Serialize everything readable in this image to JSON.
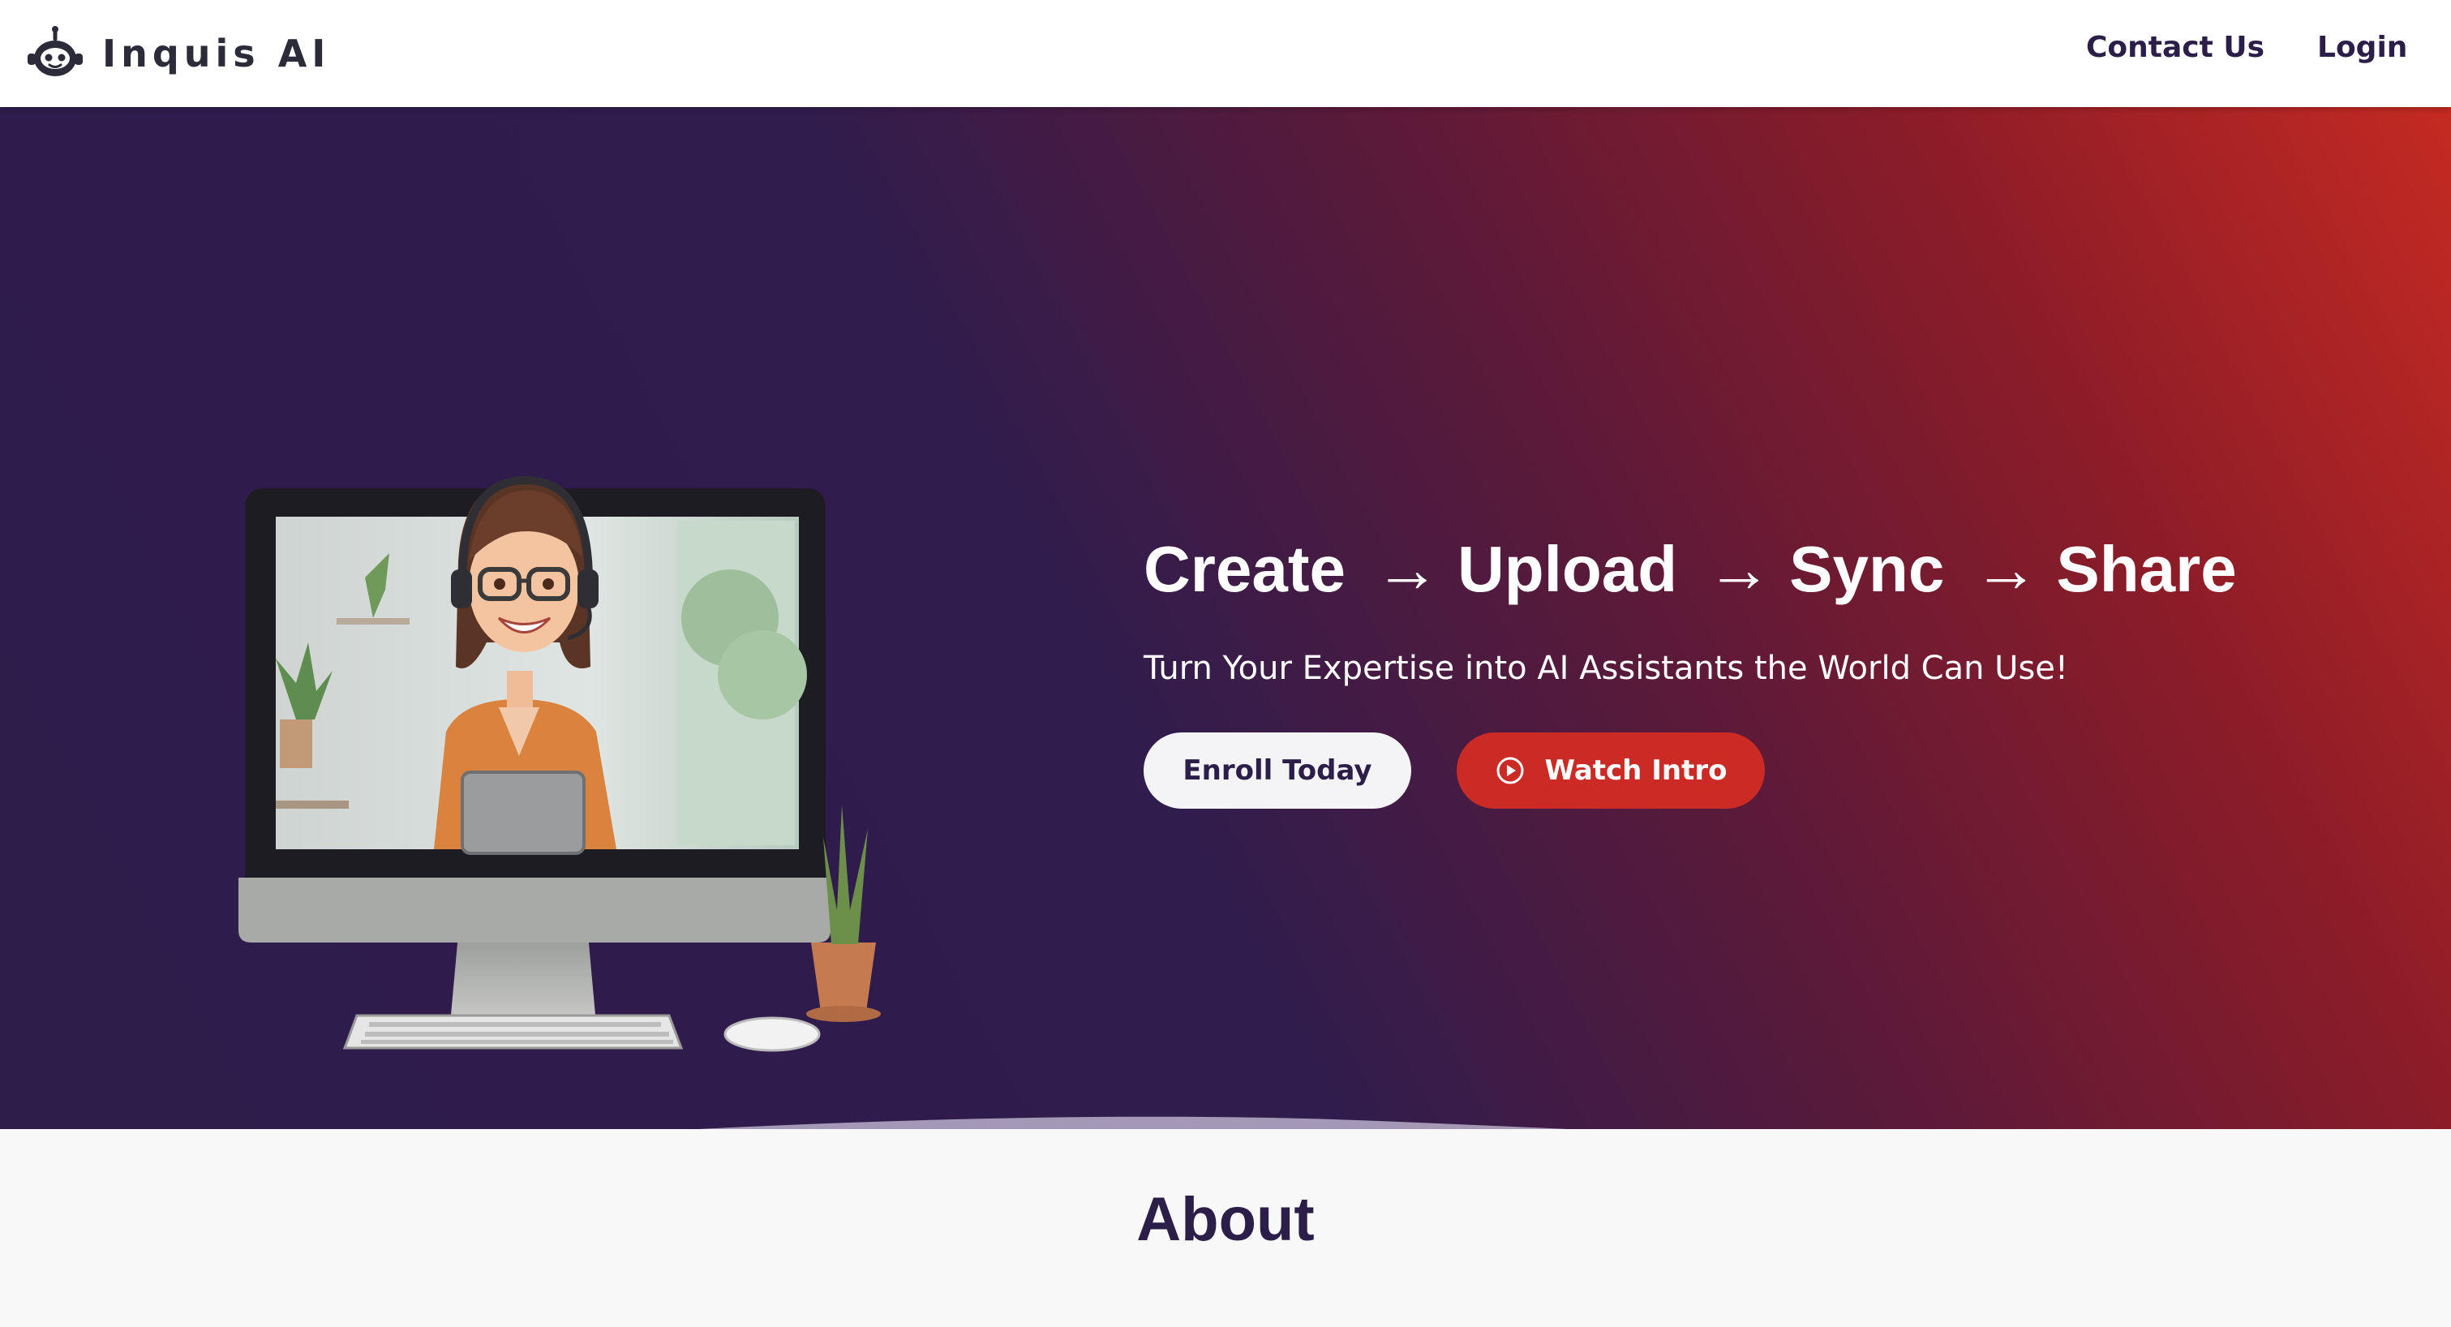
{
  "header": {
    "brand_name": "Inquis AI",
    "logo_icon": "robot-icon",
    "nav": {
      "contact_label": "Contact Us",
      "login_label": "Login"
    }
  },
  "hero": {
    "steps": [
      "Create",
      "Upload",
      "Sync",
      "Share"
    ],
    "arrow": "→",
    "subtitle": "Turn Your Expertise into AI Assistants the World Can Use!",
    "enroll_label": "Enroll Today",
    "watch_label": "Watch Intro",
    "watch_icon": "play-circle-icon",
    "illustration": "woman-on-computer-monitor-illustration"
  },
  "about": {
    "title": "About"
  },
  "colors": {
    "brand_dark": "#2b1f4a",
    "hero_start": "#2e1c4b",
    "hero_end": "#c42a22",
    "accent_red": "#cc2a24"
  }
}
